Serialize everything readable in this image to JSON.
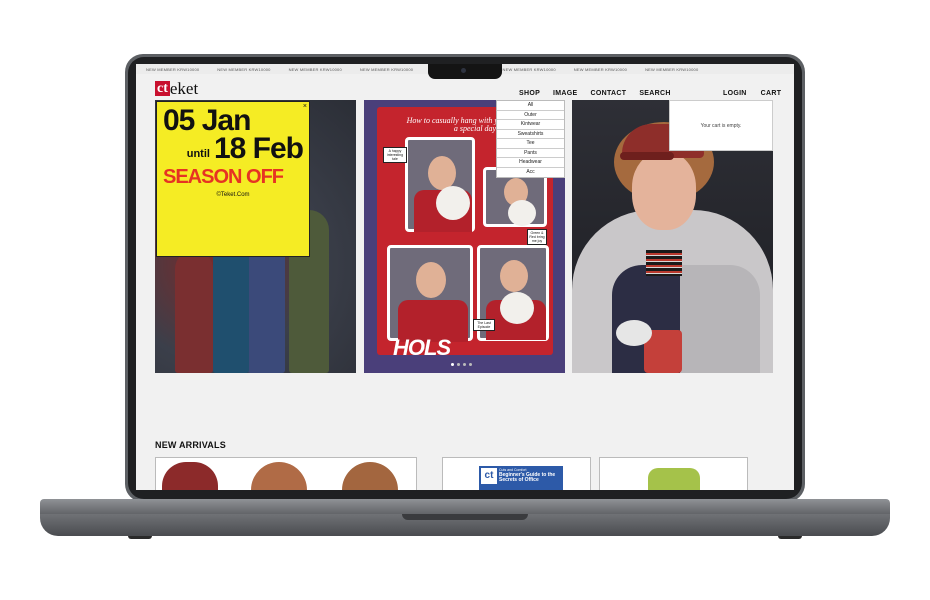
{
  "ticker": {
    "items": [
      "NEW MEMBER KRW10000",
      "NEW MEMBER KRW10000",
      "NEW MEMBER KRW10000",
      "NEW MEMBER KRW10000",
      "NEW MEMBER KRW10000",
      "NEW MEMBER KRW10000",
      "NEW MEMBER KRW10000",
      "NEW MEMBER KRW10000"
    ]
  },
  "brand": {
    "logo_mark": "ct",
    "logo_text": "eket"
  },
  "nav": {
    "shop": "SHOP",
    "image": "IMAGE",
    "contact": "CONTACT",
    "search": "SEARCH",
    "login": "LOGIN",
    "cart": "CART"
  },
  "shop_menu": [
    "All",
    "Outer",
    "Kintwear",
    "Sweatshirts",
    "Tee",
    "Pants",
    "Headwear",
    "Acc"
  ],
  "cart": {
    "empty_text": "Your cart is empty."
  },
  "promo": {
    "date_start": "05 Jan",
    "until": "until",
    "date_end": "18 Feb",
    "headline": "SEASON OFF",
    "copyright": "©Teket.Com",
    "close": "×"
  },
  "photobooth": {
    "title": "How to casually hang with your friends on a special day",
    "sticker1": "A happy interesting tale",
    "sticker2": "Green & Red bring me joy",
    "sticker3": "The Last Episode",
    "banner": "HOLS"
  },
  "carousel": {
    "count": 4,
    "active": 0
  },
  "new_arrivals": {
    "title": "NEW ARRIVALS",
    "book_mark": "ct",
    "book_kicker": "Cuts and Comfort",
    "book_title": "Beginner's Guide to the Secrets of Office"
  },
  "colors": {
    "accent_red": "#c8102e",
    "promo_yellow": "#f5ec24",
    "promo_red": "#e63323",
    "laptop_gray": "#5d6064"
  }
}
